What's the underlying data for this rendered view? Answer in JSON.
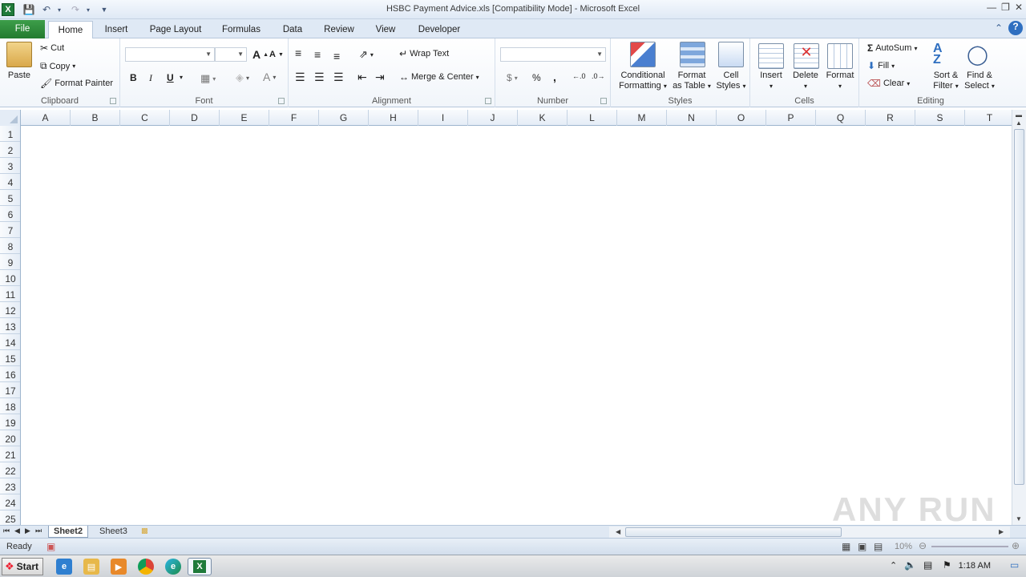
{
  "window": {
    "title": "HSBC Payment Advice.xls  [Compatibility Mode]  -  Microsoft Excel",
    "app_icon": "excel-icon"
  },
  "tabs": [
    "File",
    "Home",
    "Insert",
    "Page Layout",
    "Formulas",
    "Data",
    "Review",
    "View",
    "Developer"
  ],
  "active_tab": "Home",
  "ribbon": {
    "clipboard": {
      "label": "Clipboard",
      "paste": "Paste",
      "cut": "Cut",
      "copy": "Copy",
      "format_painter": "Format Painter"
    },
    "font": {
      "label": "Font",
      "bold": "B",
      "italic": "I",
      "underline": "U"
    },
    "alignment": {
      "label": "Alignment",
      "wrap_text": "Wrap Text",
      "merge_center": "Merge & Center"
    },
    "number": {
      "label": "Number",
      "currency": "$",
      "percent": "%",
      "comma": ","
    },
    "styles": {
      "label": "Styles",
      "conditional_1": "Conditional",
      "conditional_2": "Formatting",
      "format_table_1": "Format",
      "format_table_2": "as Table",
      "cell_styles_1": "Cell",
      "cell_styles_2": "Styles"
    },
    "cells": {
      "label": "Cells",
      "insert": "Insert",
      "delete": "Delete",
      "format": "Format"
    },
    "editing": {
      "label": "Editing",
      "autosum": "AutoSum",
      "fill": "Fill",
      "clear": "Clear",
      "sort_1": "Sort &",
      "sort_2": "Filter",
      "find_1": "Find &",
      "find_2": "Select"
    }
  },
  "grid": {
    "columns": [
      "A",
      "B",
      "C",
      "D",
      "E",
      "F",
      "G",
      "H",
      "I",
      "J",
      "K",
      "L",
      "M",
      "N",
      "O",
      "P",
      "Q",
      "R",
      "S",
      "T"
    ],
    "rows": [
      "1",
      "2",
      "3",
      "4",
      "5",
      "6",
      "7",
      "8",
      "9",
      "10",
      "11",
      "12",
      "13",
      "14",
      "15",
      "16",
      "17",
      "18",
      "19",
      "20",
      "21",
      "22",
      "23",
      "24",
      "25"
    ]
  },
  "sheets": [
    "Sheet2",
    "Sheet3"
  ],
  "active_sheet": "Sheet2",
  "status": {
    "ready": "Ready",
    "zoom": "10%"
  },
  "taskbar": {
    "start": "Start",
    "clock": "1:18 AM"
  },
  "watermark": "ANY RUN"
}
